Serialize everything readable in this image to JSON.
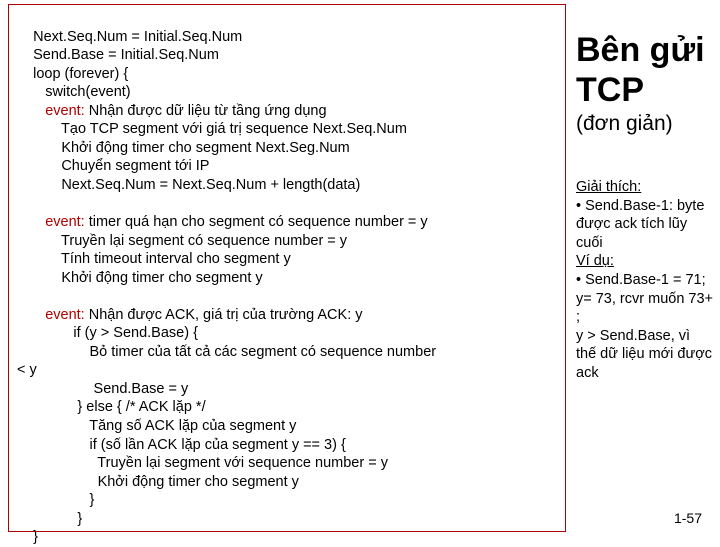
{
  "code": {
    "l1": "    Next.Seq.Num = Initial.Seq.Num",
    "l2": "    Send.Base = Initial.Seq.Num",
    "l3": "    loop (forever) {",
    "l4": "       switch(event)",
    "l5p": "       ",
    "l5e": "event:",
    "l5s": " Nhận được dữ liệu từ tầng ứng dụng",
    "l6": "           Tạo TCP segment với giá trị sequence Next.Seq.Num",
    "l7": "           Khởi động timer cho segment Next.Seg.Num",
    "l8": "           Chuyển segment tới IP",
    "l9": "           Next.Seq.Num = Next.Seq.Num + length(data)",
    "l10": "",
    "l11p": "       ",
    "l11e": "event:",
    "l11s": " timer quá hạn cho segment có sequence number = y",
    "l12": "           Truyền lại segment có sequence number = y",
    "l13": "           Tính timeout interval cho segment y",
    "l14": "           Khởi động timer cho segment y",
    "l15": "",
    "l16p": "       ",
    "l16e": "event:",
    "l16s": " Nhận được ACK, giá trị của trường ACK: y",
    "l17": "              if (y > Send.Base) {",
    "l18": "                  Bỏ timer của tất cả các segment có sequence number",
    "l19": "< y",
    "l20": "                   Send.Base = y",
    "l21": "               } else { /* ACK lặp */",
    "l22": "                  Tăng số ACK lặp của segment y",
    "l23": "                  if (số lần ACK lặp của segment y == 3) {",
    "l24": "                    Truyền lại segment với sequence number = y",
    "l25": "                    Khởi động timer cho segment y",
    "l26": "                  }",
    "l27": "               }",
    "l28": "    }"
  },
  "right": {
    "title1": "Bên gửi",
    "title2": "TCP",
    "subtitle": "(đơn giản)",
    "notes_head": "Giải thích:",
    "n1": "• Send.Base-1: byte được ack tích lũy cuối",
    "n2a": "Ví dụ:",
    "n2": "• Send.Base-1 = 71; y= 73, rcvr muốn 73+ ;",
    "n3": "y > Send.Base, vì thế dữ liệu mới được ack"
  },
  "pagenum": "1-57"
}
